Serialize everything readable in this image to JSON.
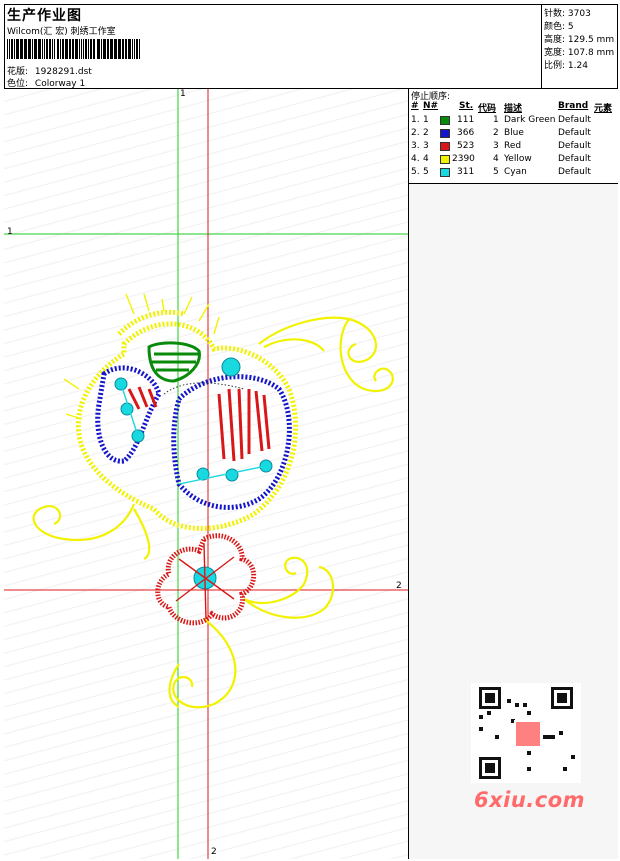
{
  "header": {
    "title": "生产作业图",
    "subtitle": "Wilcom(汇 宏) 刺绣工作室",
    "design_label": "花版:",
    "design_value": "1928291.dst",
    "colorway_label": "色位:",
    "colorway_value": "Colorway 1"
  },
  "specs": [
    {
      "label": "针数:",
      "value": "3703"
    },
    {
      "label": "颜色:",
      "value": "5"
    },
    {
      "label": "高度:",
      "value": "129.5 mm"
    },
    {
      "label": "宽度:",
      "value": "107.8 mm"
    },
    {
      "label": "比例:",
      "value": "1.24"
    }
  ],
  "stop_sequence": {
    "title": "停止顺序:",
    "columns": {
      "num": "#",
      "no": "N#",
      "stitches": "St.",
      "code": "代码",
      "description": "描述",
      "brand": "Brand",
      "element": "元素"
    },
    "threads": [
      {
        "num": "1.",
        "no": "1",
        "color": "#0a8a0a",
        "stitches": "111",
        "code": "1",
        "description": "Dark Green",
        "brand": "Default"
      },
      {
        "num": "2.",
        "no": "2",
        "color": "#1414c8",
        "stitches": "366",
        "code": "2",
        "description": "Blue",
        "brand": "Default"
      },
      {
        "num": "3.",
        "no": "3",
        "color": "#d81818",
        "stitches": "523",
        "code": "3",
        "description": "Red",
        "brand": "Default"
      },
      {
        "num": "4.",
        "no": "4",
        "color": "#f2f200",
        "stitches": "2390",
        "code": "4",
        "description": "Yellow",
        "brand": "Default"
      },
      {
        "num": "5.",
        "no": "5",
        "color": "#18d8e0",
        "stitches": "311",
        "code": "5",
        "description": "Cyan",
        "brand": "Default"
      }
    ]
  },
  "axes": {
    "v1_label": "1",
    "h1_label": "1",
    "h2_label": "2",
    "v2_label": "2"
  },
  "watermark": {
    "brand": "6xiu.com",
    "seal_text": "汇 宏 图 案"
  },
  "colors": {
    "axis_green": "#22cc22",
    "axis_red": "#e01818",
    "watermark": "#ff6b6b"
  }
}
